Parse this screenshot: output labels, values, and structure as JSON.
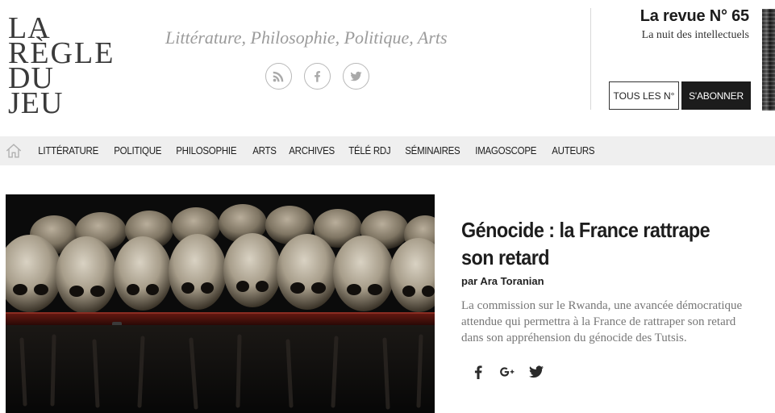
{
  "logo": {
    "line1": "LA",
    "line2": "RÈGLE",
    "line3": "DU",
    "line4": "JEU"
  },
  "tagline": "Littérature, Philosophie, Politique, Arts",
  "social": [
    "rss-icon",
    "facebook-icon",
    "twitter-icon"
  ],
  "revue": {
    "title": "La revue N° 65",
    "subtitle": "La nuit des intellectuels",
    "issues_button": "TOUS LES N°",
    "subscribe_button": "S'ABONNER"
  },
  "nav": {
    "home_icon": "home-icon",
    "items": [
      "LITTÉRATURE",
      "POLITIQUE",
      "PHILOSOPHIE",
      "ARTS",
      "ARCHIVES",
      "TÉLÉ RDJ",
      "SÉMINAIRES",
      "IMAGOSCOPE",
      "AUTEURS"
    ]
  },
  "article": {
    "title": "Génocide : la France rattrape son retard",
    "author": "par Ara Toranian",
    "excerpt_lines": [
      "La commission sur le Rwanda, une avancée démocratique",
      "attendue qui permettra à la France de rattraper son retard",
      "dans son appréhension du génocide des Tutsis."
    ],
    "share": [
      "facebook-icon",
      "google-plus-icon",
      "twitter-icon"
    ]
  },
  "colors": {
    "nav_bg": "#efefef",
    "subscribe_bg": "#1c1c1c",
    "tagline": "#9b9b9b",
    "excerpt": "#777777"
  }
}
